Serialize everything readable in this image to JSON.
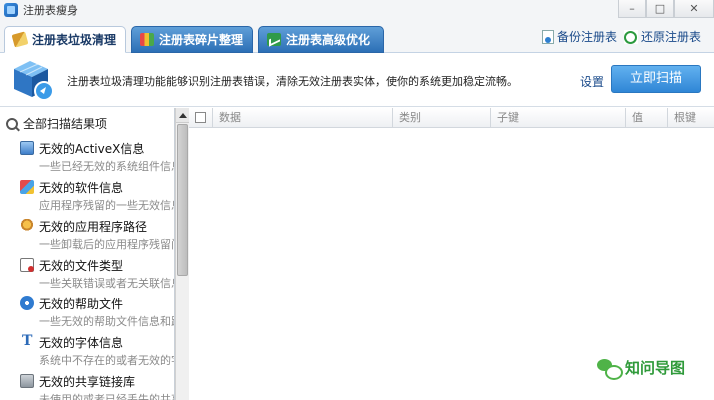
{
  "window": {
    "title": "注册表瘦身",
    "minimize": "–",
    "maximize": "□",
    "close": "✕"
  },
  "tabs": [
    {
      "label": "注册表垃圾清理",
      "icon": "broom-icon",
      "active": true
    },
    {
      "label": "注册表碎片整理",
      "icon": "puzzle-icon",
      "active": false
    },
    {
      "label": "注册表高级优化",
      "icon": "chart-icon",
      "active": false
    }
  ],
  "toplinks": {
    "backup": "备份注册表",
    "restore": "还原注册表"
  },
  "banner": {
    "description": "注册表垃圾清理功能能够识别注册表错误，清除无效注册表实体，使你的系统更加稳定流畅。",
    "settings": "设置",
    "scan_button": "立即扫描"
  },
  "sidebar": {
    "all_results": "全部扫描结果项",
    "items": [
      {
        "title": "无效的ActiveX信息",
        "desc": "一些已经无效的系统组件信息",
        "icon": "activex-icon"
      },
      {
        "title": "无效的软件信息",
        "desc": "应用程序残留的一些无效信息",
        "icon": "software-icon"
      },
      {
        "title": "无效的应用程序路径",
        "desc": "一些卸载后的应用程序残留门",
        "icon": "app-path-icon"
      },
      {
        "title": "无效的文件类型",
        "desc": "一些关联错误或者无关联信息",
        "icon": "file-type-icon"
      },
      {
        "title": "无效的帮助文件",
        "desc": "一些无效的帮助文件信息和路",
        "icon": "help-icon"
      },
      {
        "title": "无效的字体信息",
        "desc": "系统中不存在的或者无效的字",
        "icon": "font-icon"
      },
      {
        "title": "无效的共享链接库",
        "desc": "未使用的或者已经丢失的共享",
        "icon": "shared-lib-icon"
      }
    ]
  },
  "grid": {
    "columns": [
      "数据",
      "类别",
      "子键",
      "值",
      "根键"
    ]
  },
  "watermark": {
    "text": "知问导图"
  },
  "colors": {
    "tab_inactive": "#2c6fb6",
    "scan_button": "#2f86d6",
    "link": "#1a4a8a",
    "watermark": "#2f9a3a"
  }
}
